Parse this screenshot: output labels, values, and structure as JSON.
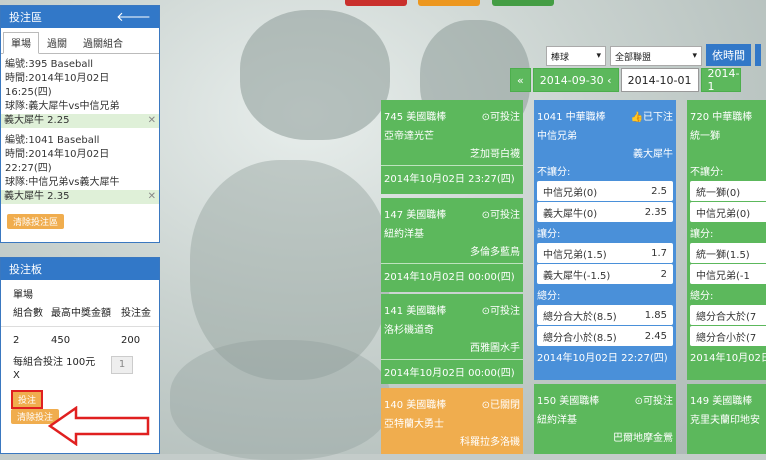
{
  "colors": {
    "panel_header": "#3278c8",
    "green": "#5cb85c",
    "blue": "#4a90d9",
    "orange": "#f0ad4e",
    "arrow": "#e02020"
  },
  "bet_panel": {
    "title": "投注區",
    "tabs": [
      "單場",
      "過關",
      "過關組合"
    ],
    "items": [
      {
        "id": "編號:395 Baseball",
        "time": "時間:2014年10月02日 16:25(四)",
        "teams": "球隊:義大犀牛vs中信兄弟",
        "pick": "義大犀牛 2.25"
      },
      {
        "id": "編號:1041 Baseball",
        "time": "時間:2014年10月02日 22:27(四)",
        "teams": "球隊:中信兄弟vs義大犀牛",
        "pick": "義大犀牛 2.35"
      }
    ],
    "clear_label": "清除投注區"
  },
  "bet_board": {
    "title": "投注板",
    "mode": "單場",
    "headers": [
      "組合數",
      "最高中獎金額",
      "投注金"
    ],
    "row": [
      "2",
      "450",
      "200"
    ],
    "per_combo_label": "每組合投注 100元 X",
    "per_combo_value": "1",
    "submit_label": "投注",
    "clear_label": "清除投注"
  },
  "toolbar": {
    "sport": "棒球",
    "league": "全部聯盟",
    "sort_label": "依時間"
  },
  "dates": {
    "prev": "2014-09-30",
    "current": "2014-10-01",
    "next": "2014-1"
  },
  "cards": [
    {
      "title": "745 美國職棒",
      "status": "可投注",
      "home": "亞帝達光芒",
      "away": "芝加哥白襪",
      "time": "2014年10月02日 23:27(四)"
    },
    {
      "title": "147 美國職棒",
      "status": "可投注",
      "home": "紐約洋基",
      "away": "多倫多藍鳥",
      "time": "2014年10月02日 00:00(四)"
    },
    {
      "title": "141 美國職棒",
      "status": "可投注",
      "home": "洛杉磯道奇",
      "away": "西雅圖水手",
      "time": "2014年10月02日 00:00(四)"
    },
    {
      "title": "140 美國職棒",
      "status": "已關閉",
      "home": "亞特蘭大勇士",
      "away": "科羅拉多洛磯"
    }
  ],
  "card_1041": {
    "title": "1041 中華職棒",
    "status": "已下注",
    "home": "中信兄弟",
    "away": "義大犀牛",
    "sections": [
      {
        "label": "不讓分:",
        "rows": [
          [
            "中信兄弟(0)",
            "2.5"
          ],
          [
            "義大犀牛(0)",
            "2.35"
          ]
        ]
      },
      {
        "label": "讓分:",
        "rows": [
          [
            "中信兄弟(1.5)",
            "1.7"
          ],
          [
            "義大犀牛(-1.5)",
            "2"
          ]
        ]
      },
      {
        "label": "總分:",
        "rows": [
          [
            "總分合大於(8.5)",
            "1.85"
          ],
          [
            "總分合小於(8.5)",
            "2.45"
          ]
        ]
      }
    ],
    "time": "2014年10月02日 22:27(四)"
  },
  "card_720": {
    "title": "720 中華職棒",
    "home": "統一獅",
    "sections": [
      {
        "label": "不讓分:",
        "rows": [
          [
            "統一獅(0)",
            ""
          ],
          [
            "中信兄弟(0)",
            ""
          ]
        ]
      },
      {
        "label": "讓分:",
        "rows": [
          [
            "統一獅(1.5)",
            ""
          ],
          [
            "中信兄弟(-1",
            ""
          ]
        ]
      },
      {
        "label": "總分:",
        "rows": [
          [
            "總分合大於(7",
            ""
          ],
          [
            "總分合小於(7",
            ""
          ]
        ]
      }
    ],
    "time": "2014年10月02日"
  },
  "card_150": {
    "title": "150 美國職棒",
    "status": "可投注",
    "home": "紐約洋基",
    "away": "巴爾地摩金鶯"
  },
  "card_149": {
    "title": "149 美國職棒",
    "home": "克里夫蘭印地安"
  }
}
